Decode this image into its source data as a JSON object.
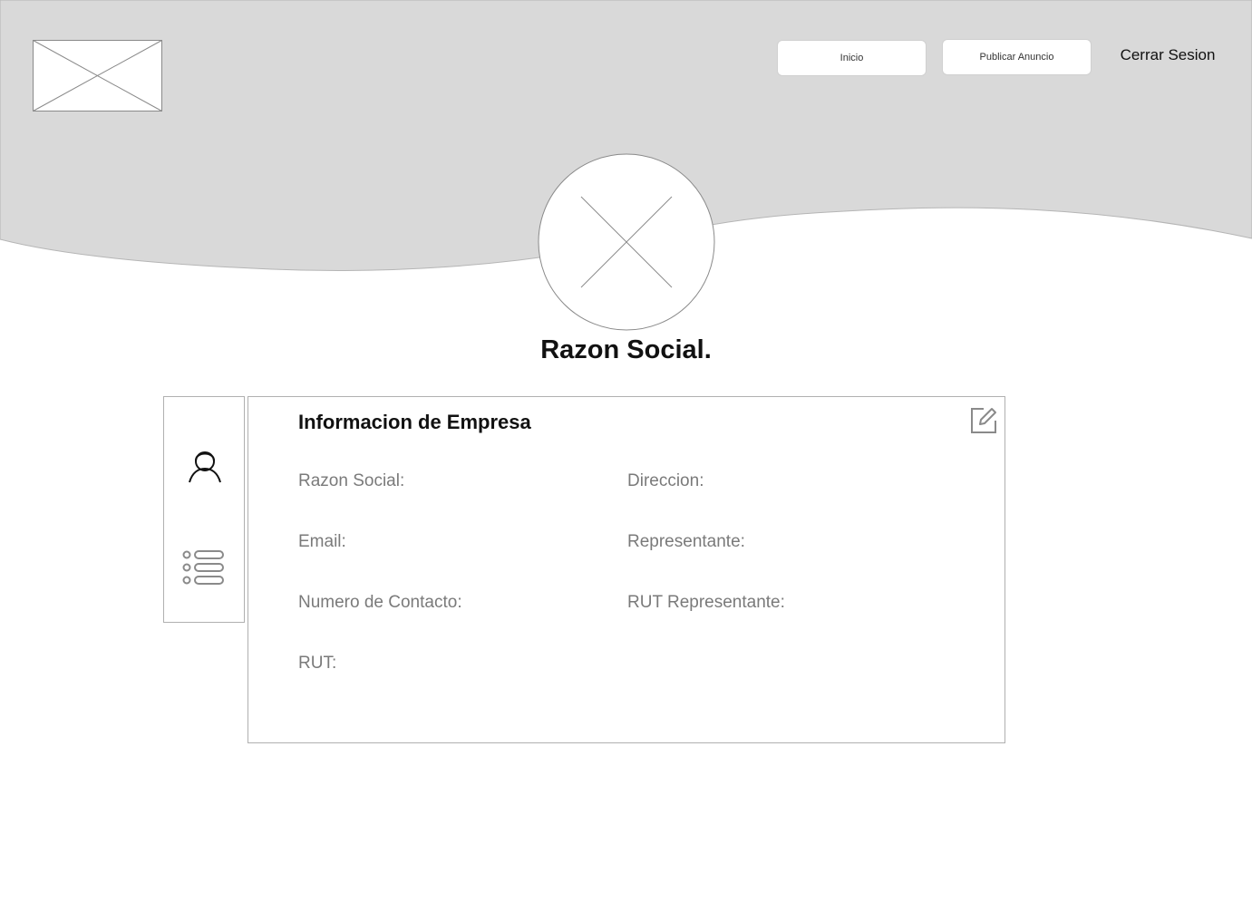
{
  "header": {
    "nav": {
      "inicio_label": "Inicio",
      "publicar_label": "Publicar Anuncio",
      "logout_label": "Cerrar Sesion"
    },
    "icons": {
      "logo": "image-placeholder-icon",
      "avatar": "avatar-placeholder-icon"
    }
  },
  "profile": {
    "title": "Razon Social."
  },
  "sidebar": {
    "items": [
      {
        "icon": "user-icon"
      },
      {
        "icon": "list-icon"
      }
    ]
  },
  "company_info": {
    "title": "Informacion de Empresa",
    "edit_icon": "edit-icon",
    "fields": {
      "razon_social": "Razon Social:",
      "email": "Email:",
      "numero_contacto": "Numero de Contacto:",
      "rut": "RUT:",
      "direccion": "Direccion:",
      "representante": "Representante:",
      "rut_representante": "RUT Representante:"
    }
  },
  "colors": {
    "header_bg": "#d9d9d9",
    "border": "#b0b0b0",
    "label_text": "#7a7a7a"
  }
}
